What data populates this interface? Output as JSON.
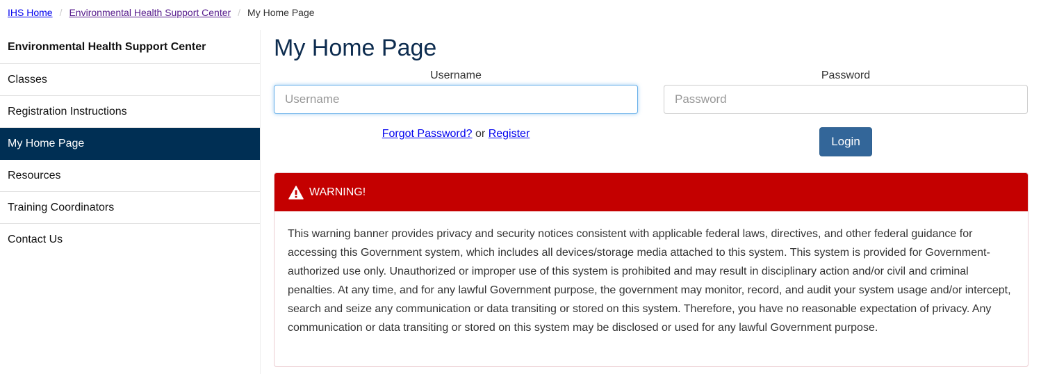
{
  "breadcrumb": {
    "items": [
      {
        "label": "IHS Home",
        "link": true
      },
      {
        "label": "Environmental Health Support Center",
        "link": true
      },
      {
        "label": "My Home Page",
        "link": false
      }
    ],
    "separator": "/"
  },
  "sidebar": {
    "heading": "Environmental Health Support Center",
    "items": [
      {
        "label": "Classes",
        "active": false
      },
      {
        "label": "Registration Instructions",
        "active": false
      },
      {
        "label": "My Home Page",
        "active": true
      },
      {
        "label": "Resources",
        "active": false
      },
      {
        "label": "Training Coordinators",
        "active": false
      },
      {
        "label": "Contact Us",
        "active": false
      }
    ],
    "active_color": "#002f54"
  },
  "main": {
    "title": "My Home Page",
    "login": {
      "username_label": "Username",
      "username_placeholder": "Username",
      "username_value": "",
      "password_label": "Password",
      "password_placeholder": "Password",
      "password_value": "",
      "forgot_password_link": "Forgot Password?",
      "or_text": "or",
      "register_link": "Register",
      "login_button": "Login",
      "button_color": "#336699"
    },
    "warning": {
      "icon": "warning-triangle-icon",
      "title": "WARNING!",
      "header_color": "#c40000",
      "body": "This warning banner provides privacy and security notices consistent with applicable federal laws, directives, and other federal guidance for accessing this Government system, which includes all devices/storage media attached to this system. This system is provided for Government-authorized use only. Unauthorized or improper use of this system is prohibited and may result in disciplinary action and/or civil and criminal penalties. At any time, and for any lawful Government purpose, the government may monitor, record, and audit your system usage and/or intercept, search and seize any communication or data transiting or stored on this system. Therefore, you have no reasonable expectation of privacy. Any communication or data transiting or stored on this system may be disclosed or used for any lawful Government purpose."
    }
  }
}
